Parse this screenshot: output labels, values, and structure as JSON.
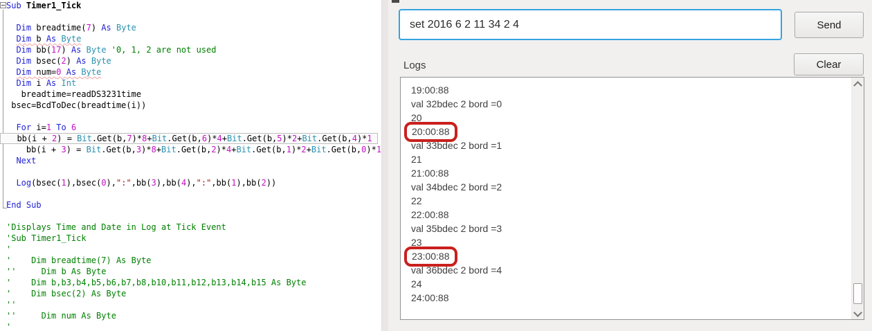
{
  "colors": {
    "accent_input_border": "#35a3e0",
    "annotation_red": "#c9201d",
    "keyword_blue": "#2222d6",
    "type_teal": "#2b91af",
    "number_magenta": "#c410c4",
    "string_maroon": "#a31515",
    "comment_green": "#008000"
  },
  "editor": {
    "lines": [
      {
        "tokens": [
          [
            "k",
            "Sub"
          ],
          [
            "p",
            " "
          ],
          [
            "b",
            "Timer1_Tick"
          ]
        ]
      },
      {
        "tokens": []
      },
      {
        "tokens": [
          [
            "p",
            "  "
          ],
          [
            "k",
            "Dim"
          ],
          [
            "p",
            " breadtime("
          ],
          [
            "n",
            "7"
          ],
          [
            "p",
            ") "
          ],
          [
            "k",
            "As"
          ],
          [
            "p",
            " "
          ],
          [
            "t",
            "Byte"
          ]
        ]
      },
      {
        "tokens": [
          [
            "p",
            "  "
          ],
          [
            "k u",
            "Dim"
          ],
          [
            "p u",
            " b "
          ],
          [
            "k u",
            "As"
          ],
          [
            "p u",
            " "
          ],
          [
            "t u",
            "Byte"
          ]
        ]
      },
      {
        "tokens": [
          [
            "p",
            "  "
          ],
          [
            "k",
            "Dim"
          ],
          [
            "p",
            " bb("
          ],
          [
            "n",
            "17"
          ],
          [
            "p",
            ") "
          ],
          [
            "k",
            "As"
          ],
          [
            "p",
            " "
          ],
          [
            "t",
            "Byte"
          ],
          [
            "p",
            " "
          ],
          [
            "c",
            "'0, 1, 2 are not used"
          ]
        ]
      },
      {
        "tokens": [
          [
            "p",
            "  "
          ],
          [
            "k",
            "Dim"
          ],
          [
            "p",
            " bsec("
          ],
          [
            "n",
            "2"
          ],
          [
            "p",
            ") "
          ],
          [
            "k",
            "As"
          ],
          [
            "p",
            " "
          ],
          [
            "t",
            "Byte"
          ]
        ]
      },
      {
        "tokens": [
          [
            "p",
            "  "
          ],
          [
            "k u",
            "Dim"
          ],
          [
            "p u",
            " num="
          ],
          [
            "n u",
            "0"
          ],
          [
            "p u",
            " "
          ],
          [
            "k u",
            "As"
          ],
          [
            "p u",
            " "
          ],
          [
            "t u",
            "Byte"
          ]
        ]
      },
      {
        "tokens": [
          [
            "p",
            "  "
          ],
          [
            "k",
            "Dim"
          ],
          [
            "p",
            " i "
          ],
          [
            "k",
            "As"
          ],
          [
            "p",
            " "
          ],
          [
            "t",
            "Int"
          ]
        ]
      },
      {
        "tokens": [
          [
            "p",
            "   breadtime=readDS3231time"
          ]
        ]
      },
      {
        "tokens": [
          [
            "p",
            " bsec=BcdToDec(breadtime(i))"
          ]
        ]
      },
      {
        "tokens": []
      },
      {
        "tokens": [
          [
            "p",
            "  "
          ],
          [
            "k",
            "For"
          ],
          [
            "p",
            " i="
          ],
          [
            "n",
            "1"
          ],
          [
            "p",
            " "
          ],
          [
            "k",
            "To"
          ],
          [
            "p",
            " "
          ],
          [
            "n",
            "6"
          ]
        ]
      },
      {
        "highlight": true,
        "tokens": [
          [
            "p",
            "  bb(i + "
          ],
          [
            "n",
            "2"
          ],
          [
            "p",
            ") = "
          ],
          [
            "t",
            "Bit"
          ],
          [
            "p",
            ".Get(b,"
          ],
          [
            "n",
            "7"
          ],
          [
            "p",
            ")*"
          ],
          [
            "n",
            "8"
          ],
          [
            "p",
            "+"
          ],
          [
            "t",
            "Bit"
          ],
          [
            "p",
            ".Get(b,"
          ],
          [
            "n",
            "6"
          ],
          [
            "p",
            ")*"
          ],
          [
            "n",
            "4"
          ],
          [
            "p",
            "+"
          ],
          [
            "t",
            "Bit"
          ],
          [
            "p",
            ".Get(b,"
          ],
          [
            "n",
            "5"
          ],
          [
            "p",
            ")*"
          ],
          [
            "n",
            "2"
          ],
          [
            "p",
            "+"
          ],
          [
            "t",
            "Bit"
          ],
          [
            "p",
            ".Get(b,"
          ],
          [
            "n",
            "4"
          ],
          [
            "p",
            ")*"
          ],
          [
            "n",
            "1"
          ]
        ]
      },
      {
        "tokens": [
          [
            "p",
            "    bb(i + "
          ],
          [
            "n",
            "3"
          ],
          [
            "p",
            ") = "
          ],
          [
            "t",
            "Bit"
          ],
          [
            "p",
            ".Get(b,"
          ],
          [
            "n",
            "3"
          ],
          [
            "p",
            ")*"
          ],
          [
            "n",
            "8"
          ],
          [
            "p",
            "+"
          ],
          [
            "t",
            "Bit"
          ],
          [
            "p",
            ".Get(b,"
          ],
          [
            "n",
            "2"
          ],
          [
            "p",
            ")*"
          ],
          [
            "n",
            "4"
          ],
          [
            "p",
            "+"
          ],
          [
            "t",
            "Bit"
          ],
          [
            "p",
            ".Get(b,"
          ],
          [
            "n",
            "1"
          ],
          [
            "p",
            ")*"
          ],
          [
            "n",
            "2"
          ],
          [
            "p",
            "+"
          ],
          [
            "t",
            "Bit"
          ],
          [
            "p",
            ".Get(b,"
          ],
          [
            "n",
            "0"
          ],
          [
            "p",
            ")*"
          ],
          [
            "n",
            "1"
          ]
        ]
      },
      {
        "tokens": [
          [
            "p",
            "  "
          ],
          [
            "k",
            "Next"
          ]
        ]
      },
      {
        "tokens": []
      },
      {
        "tokens": [
          [
            "p",
            "  "
          ],
          [
            "k",
            "Log"
          ],
          [
            "p",
            "(bsec("
          ],
          [
            "n",
            "1"
          ],
          [
            "p",
            "),bsec("
          ],
          [
            "n",
            "0"
          ],
          [
            "p",
            "),"
          ],
          [
            "s",
            "\":\""
          ],
          [
            "p",
            ",bb("
          ],
          [
            "n",
            "3"
          ],
          [
            "p",
            "),bb("
          ],
          [
            "n",
            "4"
          ],
          [
            "p",
            "),"
          ],
          [
            "s",
            "\":\""
          ],
          [
            "p",
            ",bb("
          ],
          [
            "n",
            "1"
          ],
          [
            "p",
            "),bb("
          ],
          [
            "n",
            "2"
          ],
          [
            "p",
            "))"
          ]
        ]
      },
      {
        "tokens": []
      },
      {
        "tokens": [
          [
            "k",
            "End Sub"
          ]
        ]
      },
      {
        "tokens": []
      },
      {
        "tokens": [
          [
            "c",
            "'Displays Time and Date in Log at Tick Event"
          ]
        ]
      },
      {
        "tokens": [
          [
            "c",
            "'Sub Timer1_Tick"
          ]
        ]
      },
      {
        "tokens": [
          [
            "c",
            "'"
          ]
        ]
      },
      {
        "tokens": [
          [
            "c",
            "'    Dim breadtime(7) As Byte"
          ]
        ]
      },
      {
        "tokens": [
          [
            "c",
            "''     Dim b As Byte"
          ]
        ]
      },
      {
        "tokens": [
          [
            "c",
            "'    Dim b,b3,b4,b5,b6,b7,b8,b10,b11,b12,b13,b14,b15 As Byte"
          ]
        ]
      },
      {
        "tokens": [
          [
            "c",
            "'    Dim bsec(2) As Byte"
          ]
        ]
      },
      {
        "tokens": [
          [
            "c",
            "''"
          ]
        ]
      },
      {
        "tokens": [
          [
            "c",
            "''     Dim num As Byte"
          ]
        ]
      },
      {
        "tokens": [
          [
            "c",
            "'"
          ]
        ]
      }
    ]
  },
  "right_panel": {
    "input": {
      "value": "set 2016 6 2 11 34 2 4"
    },
    "send_label": "Send",
    "clear_label": "Clear",
    "logs_label": "Logs",
    "log": {
      "lines": [
        {
          "text": "19:00:88",
          "annotated": false
        },
        {
          "text": "val 32bdec 2 bord =0",
          "annotated": false
        },
        {
          "text": "20",
          "annotated": false
        },
        {
          "text": "20:00:88",
          "annotated": true
        },
        {
          "text": "val 33bdec 2 bord =1",
          "annotated": false
        },
        {
          "text": "21",
          "annotated": false
        },
        {
          "text": "21:00:88",
          "annotated": false
        },
        {
          "text": "val 34bdec 2 bord =2",
          "annotated": false
        },
        {
          "text": "22",
          "annotated": false
        },
        {
          "text": "22:00:88",
          "annotated": false
        },
        {
          "text": "val 35bdec 2 bord =3",
          "annotated": false
        },
        {
          "text": "23",
          "annotated": false
        },
        {
          "text": "23:00:88",
          "annotated": true
        },
        {
          "text": "val 36bdec 2 bord =4",
          "annotated": false
        },
        {
          "text": "24",
          "annotated": false
        },
        {
          "text": "24:00:88",
          "annotated": false
        }
      ]
    }
  }
}
